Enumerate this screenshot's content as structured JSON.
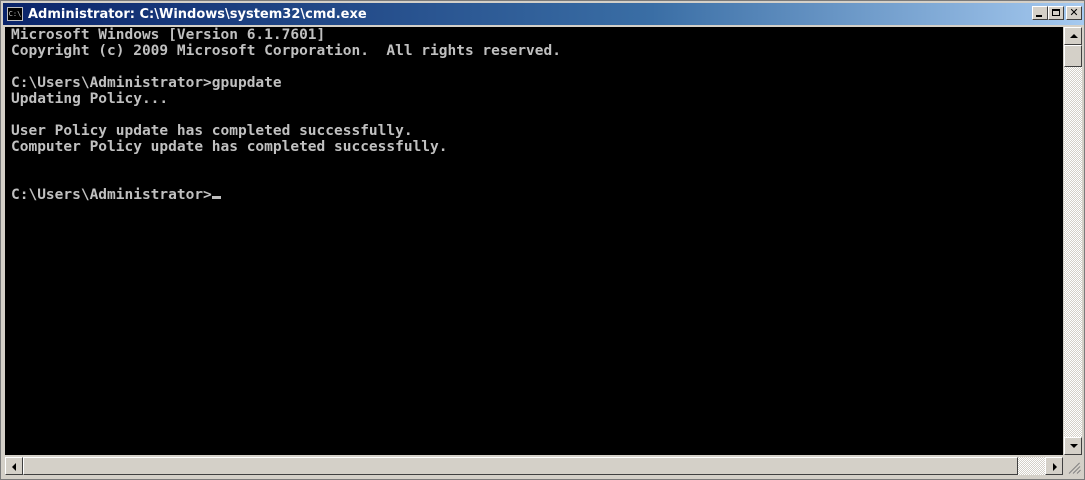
{
  "window": {
    "title": "Administrator: C:\\Windows\\system32\\cmd.exe",
    "icon_label": "C:\\",
    "icon": "cmd-icon"
  },
  "console": {
    "lines": [
      "Microsoft Windows [Version 6.1.7601]",
      "Copyright (c) 2009 Microsoft Corporation.  All rights reserved.",
      "",
      "C:\\Users\\Administrator>gpupdate",
      "Updating Policy...",
      "",
      "User Policy update has completed successfully.",
      "Computer Policy update has completed successfully.",
      "",
      "",
      "C:\\Users\\Administrator>"
    ]
  },
  "colors": {
    "console_bg": "#000000",
    "console_fg": "#c0c0c0",
    "titlebar": "#0a246a",
    "chrome": "#d4d0c8"
  }
}
